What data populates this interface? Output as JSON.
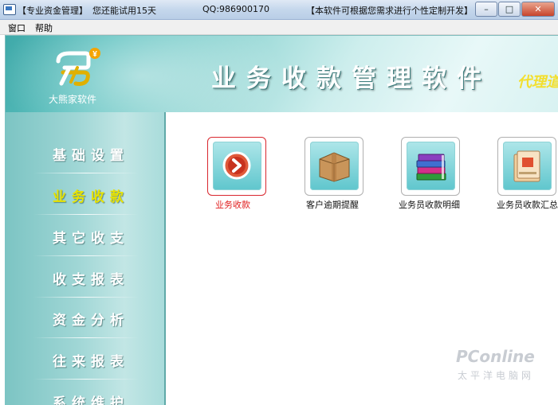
{
  "titlebar": {
    "edition": "【专业资金管理】",
    "trial": "您还能试用15天",
    "qq": "QQ:986900170",
    "notice": "【本软件可根据您需求进行个性定制开发】",
    "minimize": "–",
    "maximize": "□",
    "close": "✕"
  },
  "menu": {
    "items": [
      "窗口",
      "帮助"
    ]
  },
  "banner": {
    "logo_caption": "大熊家软件",
    "title": "业务收款管理软件",
    "subtitle": "代理道"
  },
  "sidebar": {
    "items": [
      {
        "label": "基础设置",
        "active": false
      },
      {
        "label": "业务收款",
        "active": true
      },
      {
        "label": "其它收支",
        "active": false
      },
      {
        "label": "收支报表",
        "active": false
      },
      {
        "label": "资金分析",
        "active": false
      },
      {
        "label": "往来报表",
        "active": false
      },
      {
        "label": "系统维护",
        "active": false
      }
    ]
  },
  "content": {
    "tiles": [
      {
        "label": "业务收款",
        "icon": "arrow-circle-icon",
        "selected": true
      },
      {
        "label": "客户逾期提醒",
        "icon": "box-icon",
        "selected": false
      },
      {
        "label": "业务员收款明细",
        "icon": "books-icon",
        "selected": false
      },
      {
        "label": "业务员收款汇总",
        "icon": "folder-icon",
        "selected": false
      }
    ]
  },
  "watermark": {
    "brand": "PConline",
    "sub": "太平洋电脑网"
  }
}
